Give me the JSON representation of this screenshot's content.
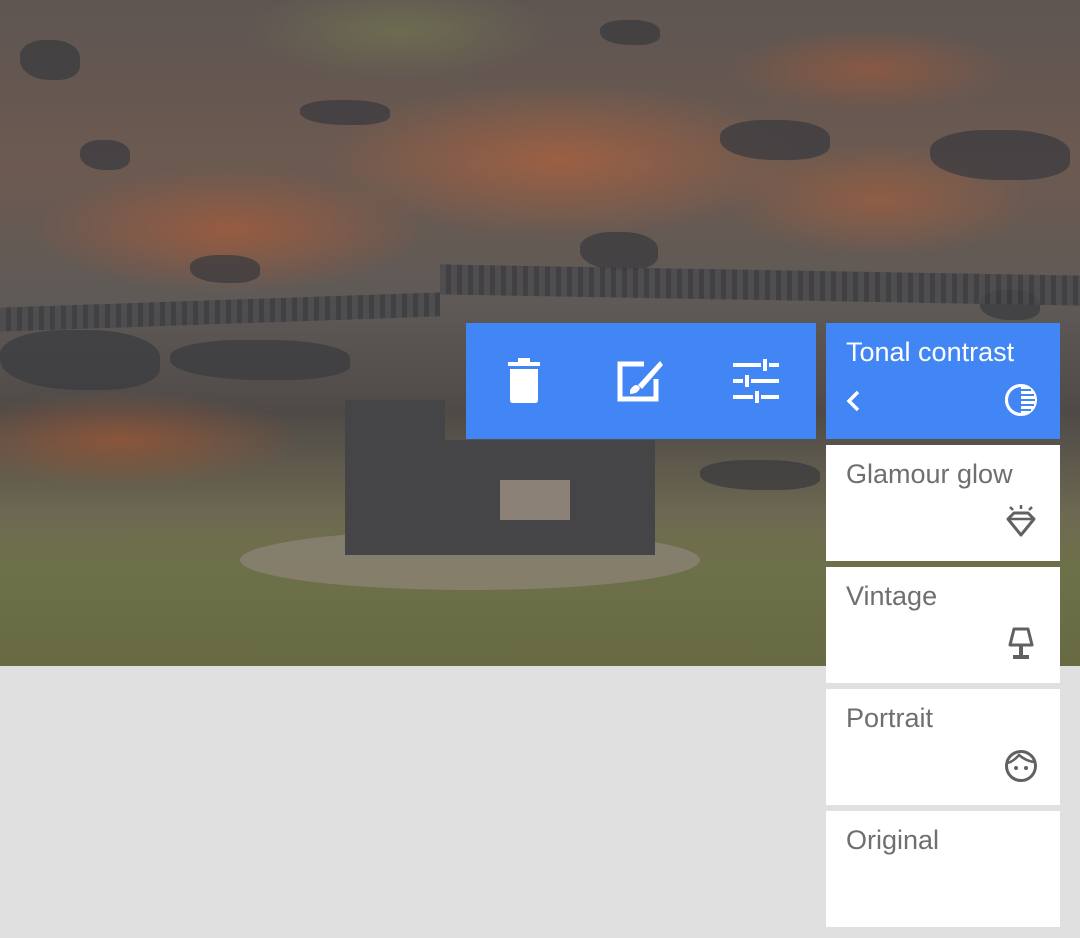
{
  "photo": {
    "subject": "rocky-hillside-with-stone-ruin"
  },
  "toolbar": {
    "buttons": [
      {
        "name": "delete",
        "icon": "trash-icon"
      },
      {
        "name": "edit",
        "icon": "edit-brush-icon"
      },
      {
        "name": "adjust",
        "icon": "sliders-icon"
      }
    ]
  },
  "filters": {
    "accent_color": "#4285f4",
    "items": [
      {
        "label": "Tonal contrast",
        "icon": "contrast-circle-icon",
        "selected": true
      },
      {
        "label": "Glamour glow",
        "icon": "diamond-icon",
        "selected": false
      },
      {
        "label": "Vintage",
        "icon": "lamp-icon",
        "selected": false
      },
      {
        "label": "Portrait",
        "icon": "face-icon",
        "selected": false
      },
      {
        "label": "Original",
        "icon": "",
        "selected": false
      }
    ],
    "back_icon": "chevron-left-icon"
  }
}
